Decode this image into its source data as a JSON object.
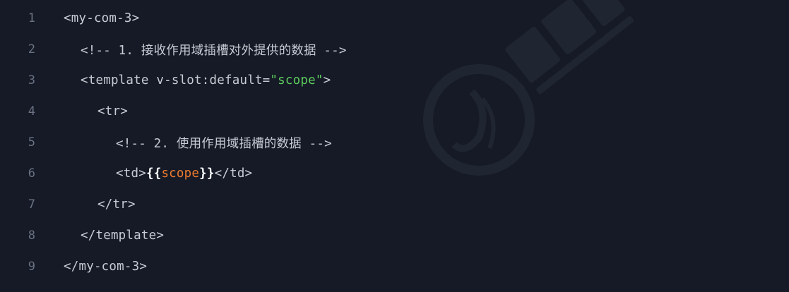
{
  "editor": {
    "lines": [
      {
        "num": "1",
        "text": "<my-com-3>"
      },
      {
        "num": "2",
        "text": "<!-- 1. 接收作用域插槽对外提供的数据 -->"
      },
      {
        "num": "3",
        "pre": "<template v-slot:default=",
        "str": "\"scope\"",
        "post": ">"
      },
      {
        "num": "4",
        "text": "<tr>"
      },
      {
        "num": "5",
        "text": "<!-- 2. 使用作用域插槽的数据 -->"
      },
      {
        "num": "6",
        "pre": "<td>",
        "brace_open": "{{",
        "var": "scope",
        "brace_close": "}}",
        "post": "</td>"
      },
      {
        "num": "7",
        "text": "</tr>"
      },
      {
        "num": "8",
        "text": "</template>"
      },
      {
        "num": "9",
        "text": "</my-com-3>"
      }
    ]
  },
  "colors": {
    "background": "#151a26",
    "line_number": "#6b7283",
    "tag": "#c7cbd4",
    "string": "#5dcb5d",
    "interpolation_brace": "#ffffff",
    "interpolation_var": "#f07a2c"
  },
  "watermark": {
    "icon": "logo-watermark-icon"
  }
}
